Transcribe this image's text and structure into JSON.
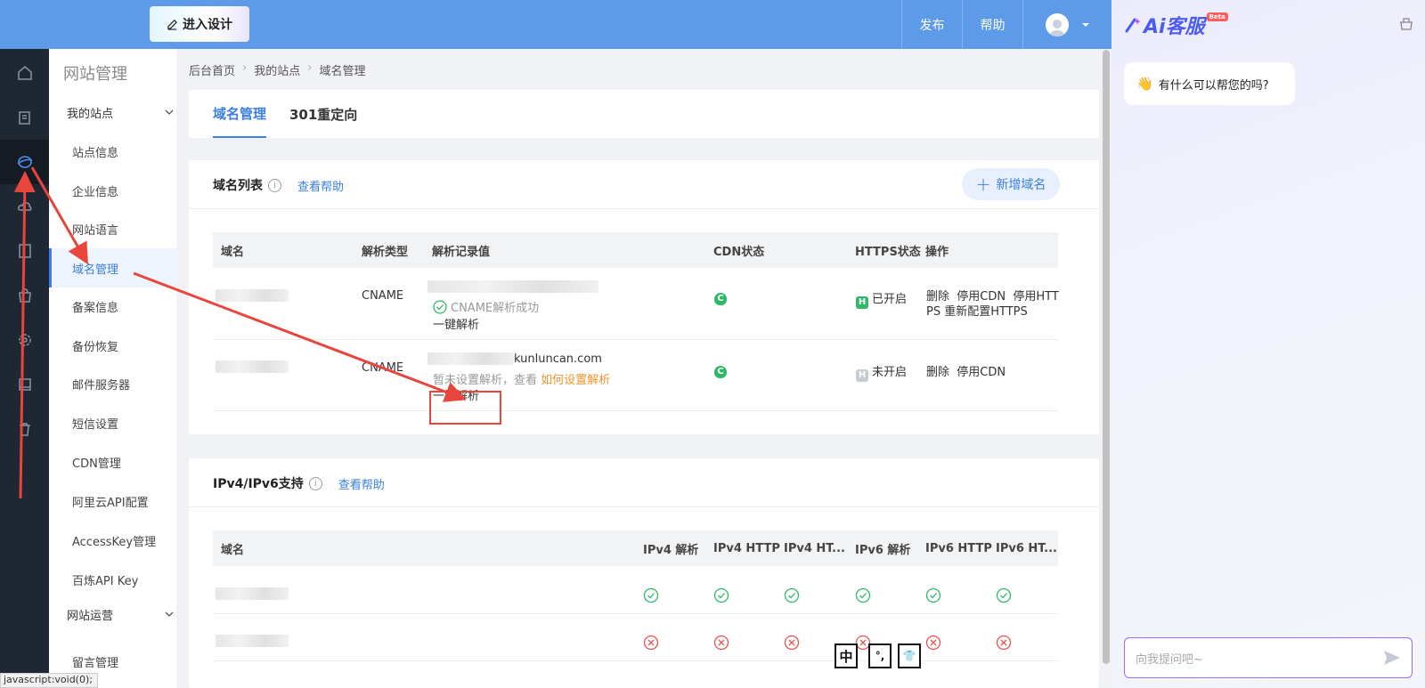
{
  "topbar": {
    "design_label": "进入设计",
    "publish_label": "发布",
    "help_label": "帮助"
  },
  "sidenav": {
    "title": "网站管理",
    "group_my_sites": "我的站点",
    "items": [
      "站点信息",
      "企业信息",
      "网站语言",
      "域名管理",
      "备案信息",
      "备份恢复",
      "邮件服务器",
      "短信设置",
      "CDN管理",
      "阿里云API配置",
      "AccessKey管理",
      "百炼API Key"
    ],
    "group_operations": "网站运营",
    "last_item": "留言管理"
  },
  "breadcrumb": [
    "后台首页",
    "我的站点",
    "域名管理"
  ],
  "tabs": [
    "域名管理",
    "301重定向"
  ],
  "domain_list": {
    "title": "域名列表",
    "help_link": "查看帮助",
    "add_button": "新增域名",
    "columns": [
      "域名",
      "解析类型",
      "解析记录值",
      "CDN状态",
      "HTTPS状态",
      "操作"
    ],
    "rows": [
      {
        "type": "CNAME",
        "status_text": "CNAME解析成功",
        "one_click": "一键解析",
        "https_state": "已开启",
        "actions": [
          "删除",
          "停用CDN",
          "停用HTTPS",
          "重新配置HTTPS"
        ]
      },
      {
        "type": "CNAME",
        "record_suffix": "kunluncan.com",
        "not_set_text": "暂未设置解析，查看",
        "how_to_link": "如何设置解析",
        "one_click": "一键解析",
        "https_state": "未开启",
        "actions": [
          "删除",
          "停用CDN"
        ]
      }
    ]
  },
  "ipv_section": {
    "title": "IPv4/IPv6支持",
    "help_link": "查看帮助",
    "columns": [
      "域名",
      "IPv4 解析",
      "IPv4 HTTP",
      "IPv4 HT...",
      "IPv6 解析",
      "IPv6 HTTP",
      "IPv6 HT..."
    ]
  },
  "ai_panel": {
    "logo": "Ai客服",
    "beta": "Beta",
    "greeting": "有什么可以帮您的吗?",
    "input_placeholder": "向我提问吧~"
  },
  "statusbar": "javascript:void(0);",
  "ime": [
    "中",
    "°,",
    "👕"
  ],
  "colors": {
    "primary": "#3b7fe0",
    "topbar": "#5d9be8",
    "success": "#2fb86a",
    "error": "#e55353",
    "annotation": "#e8453c"
  }
}
